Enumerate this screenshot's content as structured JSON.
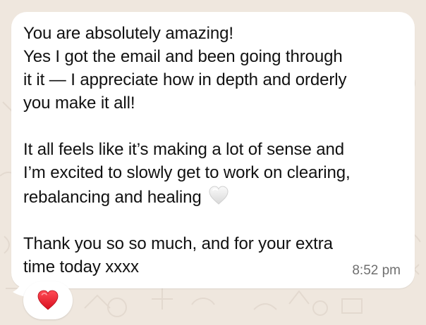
{
  "chat": {
    "background_color": "#efe7de",
    "message": {
      "lines": [
        "You are absolutely amazing!",
        "Yes I got the email and been going through",
        "it it — I appreciate how in depth and orderly",
        "you make it all!",
        "",
        "It all feels like it’s making a lot of sense and",
        "I’m excited to slowly get to work on clearing,",
        "rebalancing and healing ",
        "",
        "Thank you so so much, and for your extra",
        "time today xxxx"
      ],
      "inline_emoji": "white-heart-icon",
      "timestamp": "8:52 pm"
    },
    "reaction": {
      "emoji": "red-heart-icon",
      "color": "#e11d2e"
    }
  }
}
